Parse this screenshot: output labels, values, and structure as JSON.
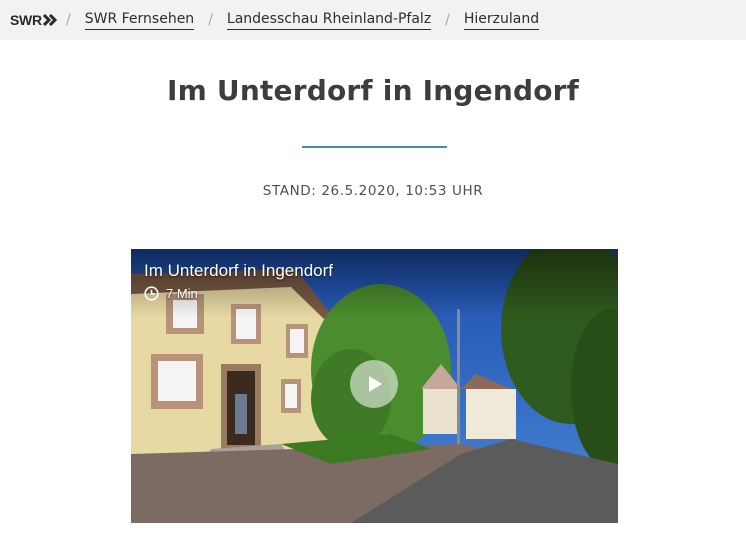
{
  "header": {
    "logo": "SWR",
    "breadcrumbs": [
      {
        "label": "SWR Fernsehen"
      },
      {
        "label": "Landesschau Rheinland-Pfalz"
      },
      {
        "label": "Hierzuland"
      }
    ],
    "separator": "/"
  },
  "article": {
    "title": "Im Unterdorf in Ingendorf",
    "stand": "STAND: 26.5.2020, 10:53 UHR",
    "accent_color": "#3e8fb7"
  },
  "video": {
    "title": "Im Unterdorf in Ingendorf",
    "duration": "7 Min",
    "icons": {
      "clock": "clock-icon",
      "play": "play-icon"
    }
  }
}
